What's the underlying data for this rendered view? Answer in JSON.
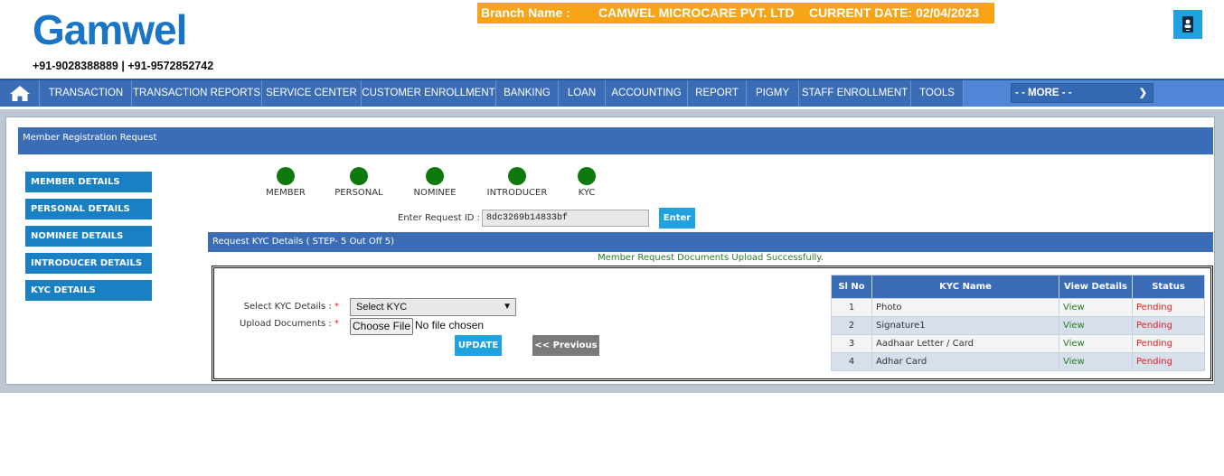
{
  "brand": {
    "logo_text": "Gamwel",
    "phone": "+91-9028388889 | +91-9572852742"
  },
  "branch": {
    "label": "Branch Name :",
    "name": "CAMWEL MICROCARE PVT. LTD",
    "date_label": "CURRENT DATE: 02/04/2023"
  },
  "nav": {
    "items": [
      "TRANSACTION",
      "TRANSACTION REPORTS",
      "SERVICE CENTER",
      "CUSTOMER ENROLLMENT",
      "BANKING",
      "LOAN",
      "ACCOUNTING",
      "REPORT",
      "PIGMY",
      "STAFF ENROLLMENT",
      "TOOLS"
    ],
    "more": "- - MORE - -"
  },
  "page": {
    "title": "Member Registration Request"
  },
  "sidebar": {
    "items": [
      "MEMBER DETAILS",
      "PERSONAL DETAILS",
      "NOMINEE DETAILS",
      "INTRODUCER DETAILS",
      "KYC DETAILS"
    ]
  },
  "steps": [
    "MEMBER",
    "PERSONAL",
    "NOMINEE",
    "INTRODUCER",
    "KYC"
  ],
  "colors": {
    "step_complete": "#0e7a0e",
    "nav_bg": "#3a6db5",
    "accent": "#1fa2e0",
    "branch_bg": "#f7a417"
  },
  "request": {
    "label": "Enter Request ID :",
    "value": "8dc3269b14833bf",
    "button": "Enter"
  },
  "kyc": {
    "bar_title": "Request KYC Details ( STEP- 5 Out Off 5)",
    "success_msg": "Member Request Documents Upload Successfully.",
    "select_label": "Select KYC Details :",
    "select_value": "Select KYC",
    "upload_label": "Upload Documents :",
    "required_mark": "*",
    "choose_file": "Choose File",
    "no_file": "No file chosen",
    "update_button": "UPDATE",
    "prev_button": "<< Previous"
  },
  "table": {
    "headers": [
      "Sl No",
      "KYC Name",
      "View Details",
      "Status"
    ],
    "rows": [
      {
        "no": "1",
        "name": "Photo",
        "view": "View",
        "status": "Pending"
      },
      {
        "no": "2",
        "name": "Signature1",
        "view": "View",
        "status": "Pending"
      },
      {
        "no": "3",
        "name": "Aadhaar Letter / Card",
        "view": "View",
        "status": "Pending"
      },
      {
        "no": "4",
        "name": "Adhar Card",
        "view": "View",
        "status": "Pending"
      }
    ]
  }
}
